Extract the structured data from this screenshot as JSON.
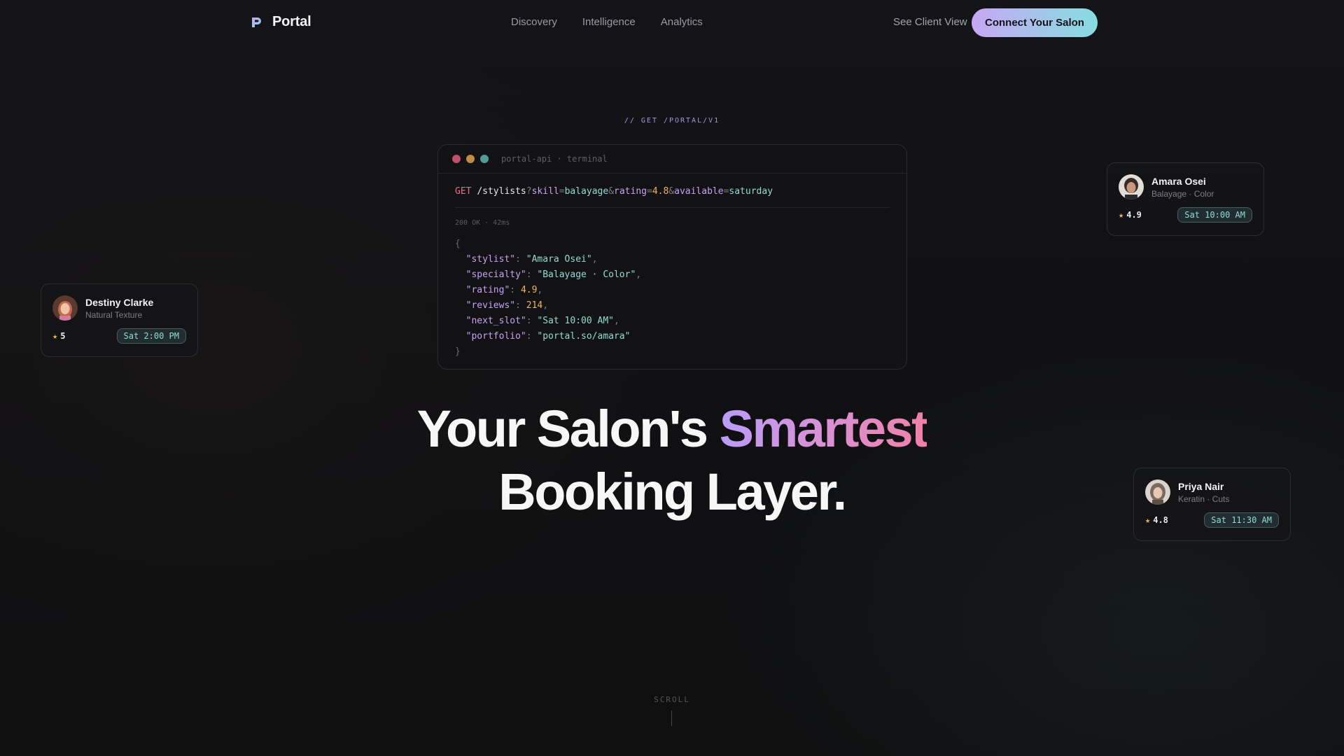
{
  "nav": {
    "brand": "Portal",
    "links": [
      "Discovery",
      "Intelligence",
      "Analytics"
    ],
    "client_view": "See Client View",
    "cta": "Connect Your Salon"
  },
  "eyebrow": "// GET /PORTAL/V1",
  "terminal": {
    "title": "portal-api · terminal",
    "method": "GET",
    "path": "/stylists",
    "query": [
      {
        "key": "skill",
        "value": "balayage",
        "kind": "str"
      },
      {
        "key": "rating",
        "value": "4.8",
        "kind": "num"
      },
      {
        "key": "available",
        "value": "saturday",
        "kind": "str"
      }
    ],
    "status": "200 OK · 42ms",
    "response": [
      {
        "key": "\"stylist\"",
        "value": "\"Amara Osei\"",
        "kind": "str"
      },
      {
        "key": "\"specialty\"",
        "value": "\"Balayage · Color\"",
        "kind": "str"
      },
      {
        "key": "\"rating\"",
        "value": "4.9",
        "kind": "num"
      },
      {
        "key": "\"reviews\"",
        "value": "214",
        "kind": "num"
      },
      {
        "key": "\"next_slot\"",
        "value": "\"Sat 10:00 AM\"",
        "kind": "str"
      },
      {
        "key": "\"portfolio\"",
        "value": "\"portal.so/amara\"",
        "kind": "str"
      }
    ]
  },
  "cards": [
    {
      "name": "Destiny Clarke",
      "specialty": "Natural Texture",
      "rating": "5",
      "slot": "Sat 2:00 PM"
    },
    {
      "name": "Amara Osei",
      "specialty": "Balayage · Color",
      "rating": "4.9",
      "slot": "Sat 10:00 AM"
    },
    {
      "name": "Priya Nair",
      "specialty": "Keratin · Cuts",
      "rating": "4.8",
      "slot": "Sat 11:30 AM"
    }
  ],
  "hero": {
    "line1_start": "Your Salon's ",
    "line1_highlight": "Smartest",
    "line2": "Booking Layer."
  },
  "scroll": "SCROLL",
  "colors": {
    "accent_purple": "#c6a2f5",
    "accent_teal": "#8fdcd3",
    "accent_pink": "#ee6a8b",
    "accent_amber": "#f2b35c"
  }
}
